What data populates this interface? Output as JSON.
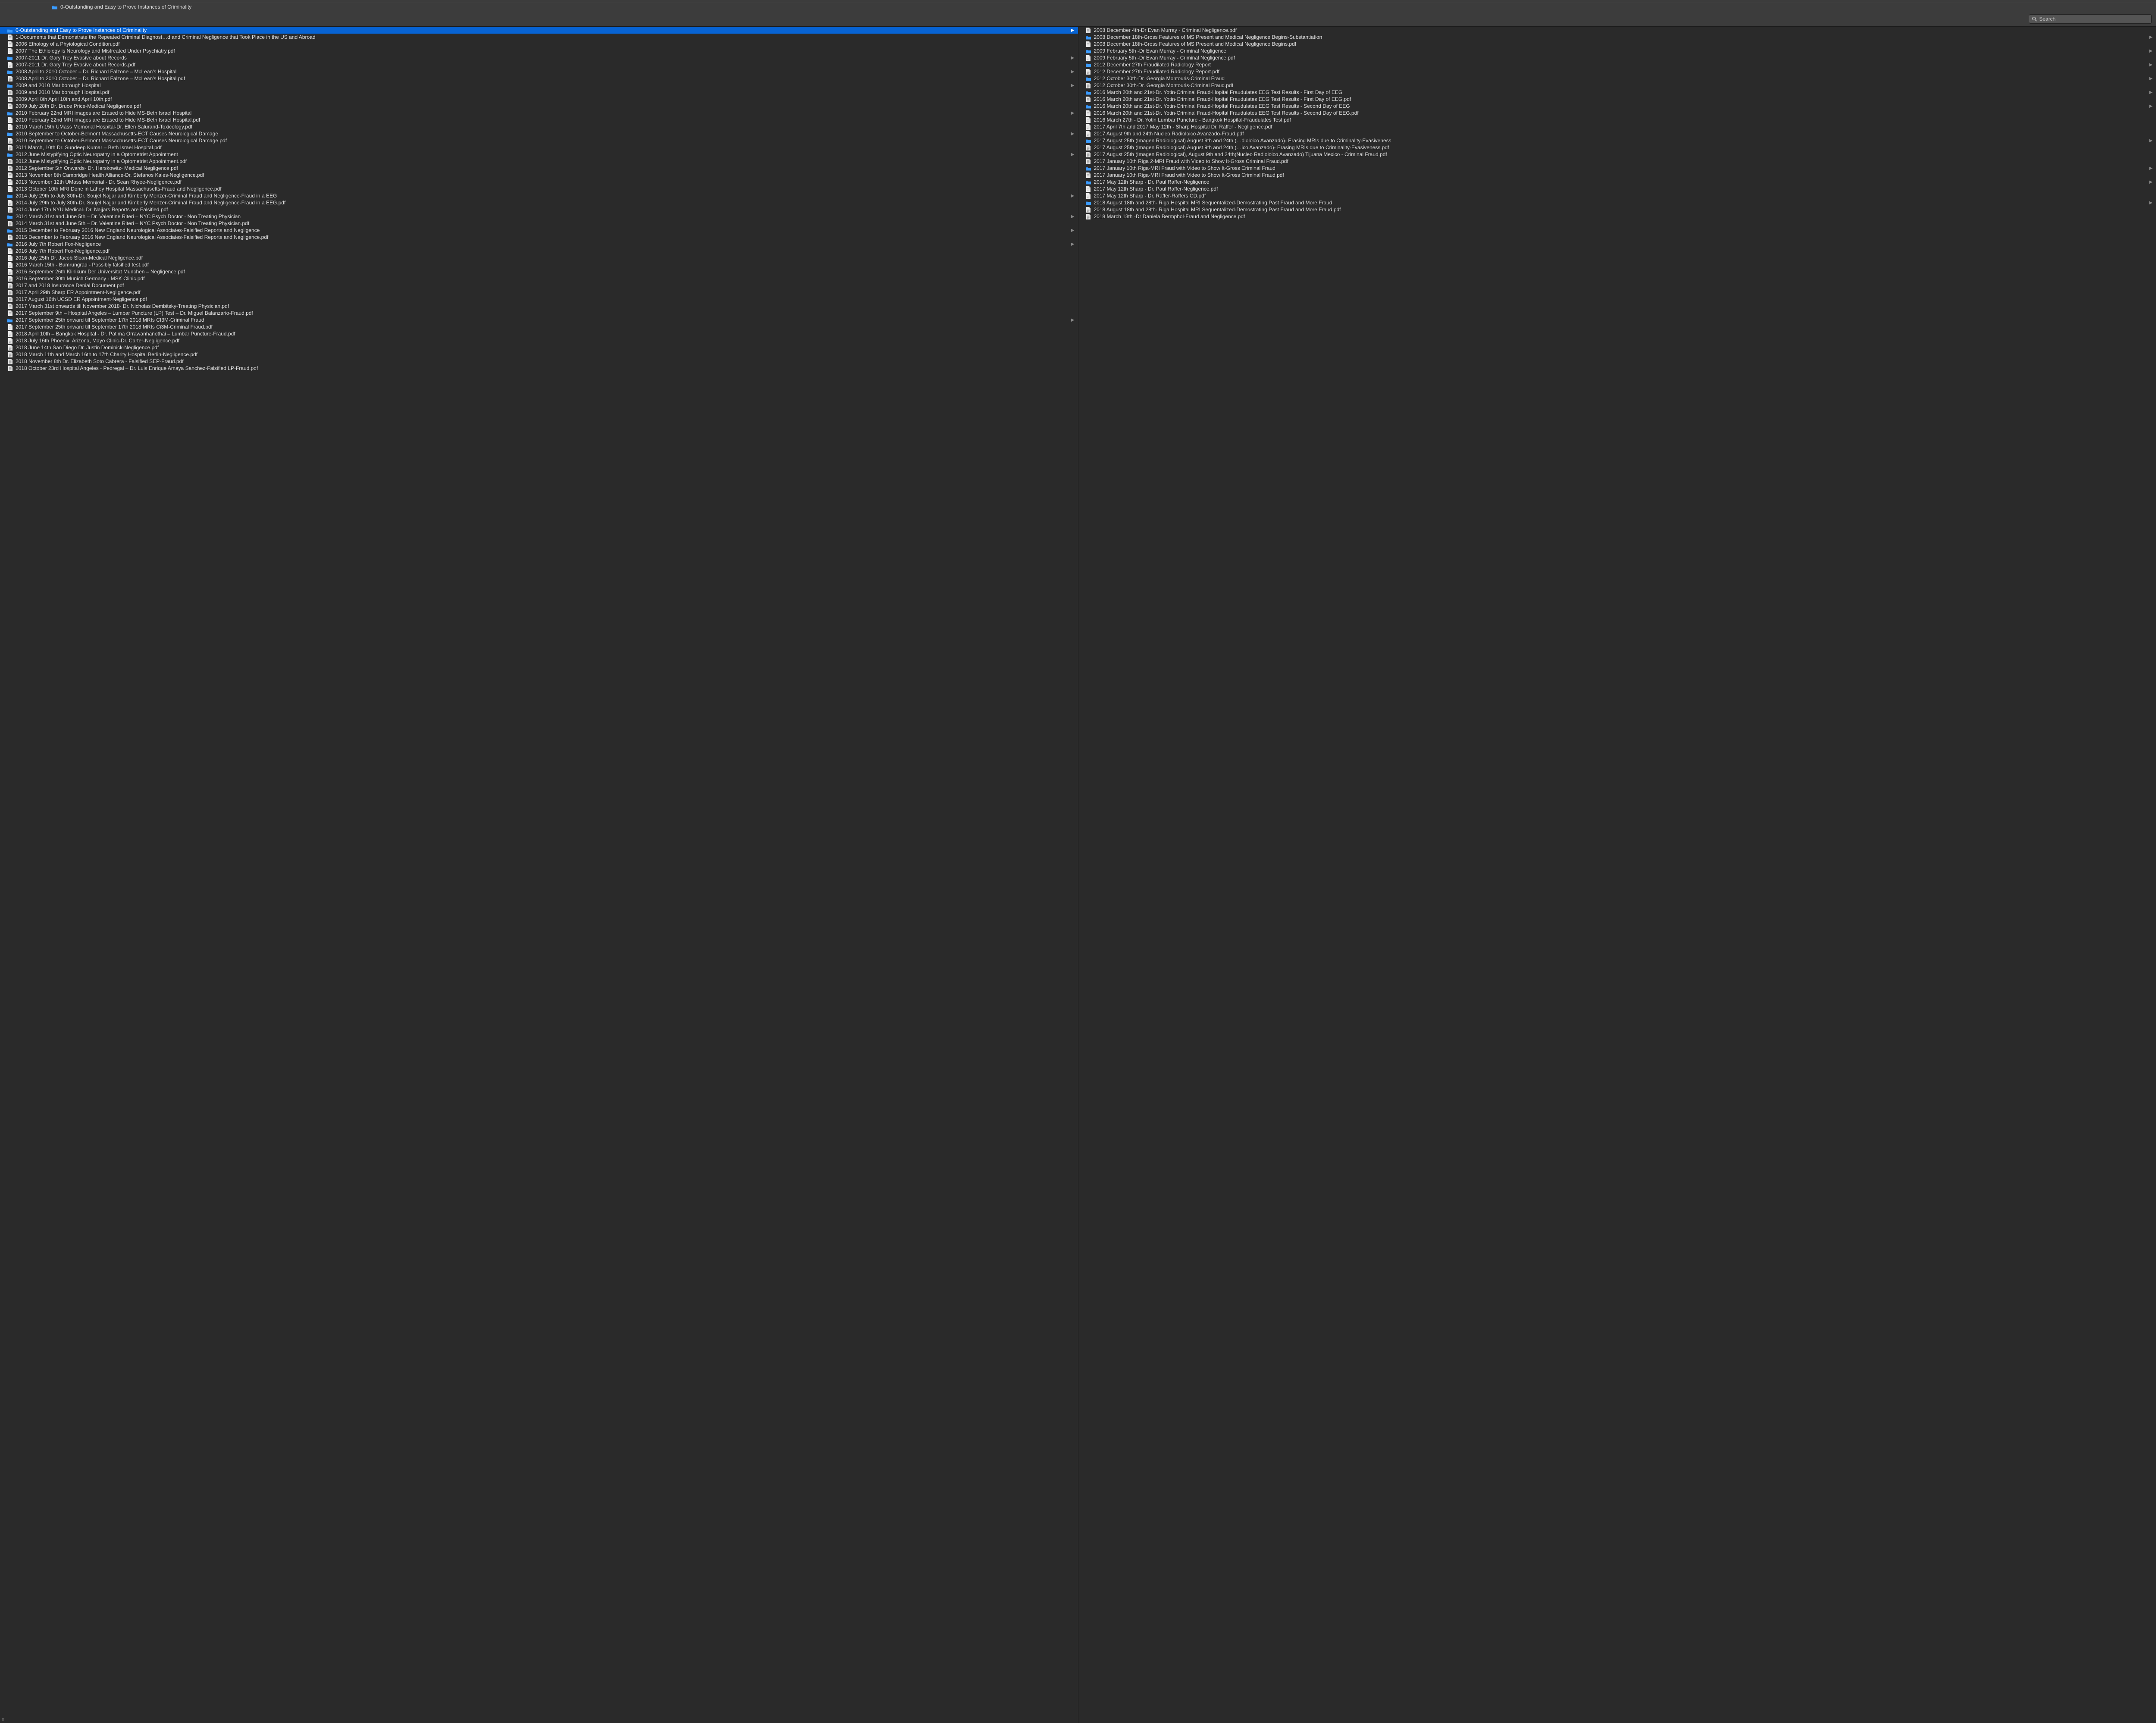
{
  "pathbar": {
    "title": "0-Outstanding and Easy to Prove Instances of Criminality"
  },
  "search": {
    "placeholder": "Search",
    "value": ""
  },
  "columns": [
    {
      "items": [
        {
          "type": "folder",
          "selected": true,
          "name": "0-Outstanding and Easy to Prove Instances of Criminality"
        },
        {
          "type": "doc",
          "name": "1-Documents that Demonstrate the Repeated Criminal Diagnost…d and Criminal Negligence that Took Place in the US and Abroad"
        },
        {
          "type": "doc",
          "name": "2006 Ethology of a Phyiological Condition.pdf"
        },
        {
          "type": "doc",
          "name": "2007 The Ethiology is Neurology and Mistreated Under Psychiatry.pdf"
        },
        {
          "type": "folder",
          "name": "2007-2011 Dr. Gary Trey Evasive about Records"
        },
        {
          "type": "doc",
          "name": "2007-2011 Dr. Gary Trey Evasive about Records.pdf"
        },
        {
          "type": "folder",
          "name": "2008 April to 2010 October  – Dr. Richard Falzone – McLean's Hospital"
        },
        {
          "type": "doc",
          "name": "2008 April to 2010 October  – Dr. Richard Falzone – McLean's Hospital.pdf"
        },
        {
          "type": "folder",
          "name": "2009 and 2010 Marlborough Hospital"
        },
        {
          "type": "doc",
          "name": "2009 and 2010 Marlborough Hospital.pdf"
        },
        {
          "type": "doc",
          "name": "2009 April 8th April 10th and April 10th.pdf"
        },
        {
          "type": "doc",
          "name": "2009 July 28th Dr. Bruce Price-Medical Negligence.pdf"
        },
        {
          "type": "folder",
          "name": "2010 February 22nd MRI images are Erased to Hide MS-Beth Israel Hospital"
        },
        {
          "type": "doc",
          "name": "2010 February 22nd MRI images are Erased to Hide MS-Beth Israel Hospital.pdf"
        },
        {
          "type": "doc",
          "name": "2010 March 15th UMass Memorial Hospital-Dr. Ellen Salurand-Toxicology.pdf"
        },
        {
          "type": "folder",
          "name": "2010 September to October-Belmont Massachusetts-ECT Causes Neurological Damage"
        },
        {
          "type": "doc",
          "name": "2010 September to October-Belmont Massachusetts-ECT Causes Neurological Damage.pdf"
        },
        {
          "type": "doc",
          "name": "2011 March, 10th  Dr. Sundeep Kumar – Beth Israel Hospital.pdf"
        },
        {
          "type": "folder",
          "name": "2012 June Mistypifying Optic Neuropathy in a Optometrist Appointment"
        },
        {
          "type": "doc",
          "name": "2012 June Mistypifying Optic Neuropathy in a Optometrist Appointment.pdf"
        },
        {
          "type": "doc",
          "name": "2012 September 5th Onwards- Dr. Herskowitz- Medical Negligence.pdf"
        },
        {
          "type": "doc",
          "name": "2013 November 8th Cambridge Health Alliance-Dr. Stefanos Kales-Negligence.pdf"
        },
        {
          "type": "doc",
          "name": "2013 November 12th UMass Memorial - Dr. Sean Rhyee-Negligence.pdf"
        },
        {
          "type": "doc",
          "name": "2013 October 10th MRI Done in Lahey Hospital Massachusetts-Fraud and Negligence.pdf"
        },
        {
          "type": "folder",
          "name": "2014 July 29th to July 30th-Dr. Soujel Najjar and Kimberly Menzer-Criminal Fraud and Negligence-Fraud in a EEG"
        },
        {
          "type": "doc",
          "name": "2014 July 29th to July 30th-Dr. Soujel Najjar and Kimberly Menzer-Criminal Fraud and Negligence-Fraud in a EEG.pdf"
        },
        {
          "type": "doc",
          "name": "2014 June 17th NYU Medical- Dr. Najjars Reports are Falsified.pdf"
        },
        {
          "type": "folder",
          "name": "2014 March 31st and June 5th – Dr. Valentine Riteri – NYC Psych Doctor - Non Treating Physician"
        },
        {
          "type": "doc",
          "name": "2014 March 31st and June 5th – Dr. Valentine Riteri – NYC Psych Doctor - Non Treating Physician.pdf"
        },
        {
          "type": "folder",
          "name": "2015 December to February 2016 New England Neurological Associates-Falsified Reports and Negligence"
        },
        {
          "type": "doc",
          "name": "2015 December to February 2016 New England Neurological Associates-Falsified Reports and Negligence.pdf"
        },
        {
          "type": "folder",
          "name": "2016 July 7th Robert Fox-Negligence"
        },
        {
          "type": "doc",
          "name": "2016 July 7th Robert Fox-Negligence.pdf"
        },
        {
          "type": "doc",
          "name": "2016 July 25th Dr. Jacob Sloan-Medical Negligence.pdf"
        },
        {
          "type": "doc",
          "name": "2016 March 15th - Bumrungrad - Possibly falsified test.pdf"
        },
        {
          "type": "doc",
          "name": "2016 September 26th Klinikum Der Universitat Munchen – Negligence.pdf"
        },
        {
          "type": "doc",
          "name": "2016 September 30th Munich Germany - MSK Clinic.pdf"
        },
        {
          "type": "doc",
          "name": "2017 and 2018 Insurance Denial Document.pdf"
        },
        {
          "type": "doc",
          "name": "2017 April 29th Sharp ER Appointment-Negligence.pdf"
        },
        {
          "type": "doc",
          "name": "2017 August 16th  UCSD ER Appointment-Negligence.pdf"
        },
        {
          "type": "doc",
          "name": "2017 March 31st onwards till November 2018- Dr. Nicholas Dembitsky-Treating Physician.pdf"
        },
        {
          "type": "doc",
          "name": "2017 September 9th – Hospital Angeles – Lumbar Puncture (LP) Test – Dr. Miguel Balanzario-Fraud.pdf"
        },
        {
          "type": "folder",
          "name": "2017 September 25th onward till September 17th 2018  MRIs CI3M-Criminal Fraud"
        },
        {
          "type": "doc",
          "name": "2017 September 25th onward till September 17th 2018  MRIs Ci3M-Criminal Fraud.pdf"
        },
        {
          "type": "doc",
          "name": "2018 April 10th – Bangkok Hospital - Dr. Patima Orrawanhanothai – Lumbar Puncture-Fraud.pdf"
        },
        {
          "type": "doc",
          "name": "2018 July 16th  Phoenix, Arizona, Mayo Clinic-Dr. Carter-Negligence.pdf"
        },
        {
          "type": "doc",
          "name": "2018 June 14th San Diego Dr. Justin Dominick-Negligence.pdf"
        },
        {
          "type": "doc",
          "name": "2018 March 11th and March 16th to 17th Charity Hospital Berlin-Negligence.pdf"
        },
        {
          "type": "doc",
          "name": "2018 November 8th Dr. Elizabeth Soto Cabrera - Falsified SEP-Fraud.pdf"
        },
        {
          "type": "doc",
          "name": "2018 October 23rd Hospital Angeles - Pedregal – Dr. Luis Enrique Amaya Sanchez-Falsified LP-Fraud.pdf"
        }
      ]
    },
    {
      "items": [
        {
          "type": "doc",
          "name": "2008 December 4th-Dr Evan Murray - Criminal Negligence.pdf"
        },
        {
          "type": "folder",
          "name": "2008 December 18th-Gross Features of MS Present and Medical Negligence Begins-Substantiation"
        },
        {
          "type": "doc",
          "name": "2008 December 18th-Gross Features of MS Present and Medical Negligence Begins.pdf"
        },
        {
          "type": "folder",
          "name": "2009 February 5th -Dr Evan Murray - Criminal Negligence"
        },
        {
          "type": "doc",
          "name": "2009 February 5th -Dr Evan Murray - Criminal Negligence.pdf"
        },
        {
          "type": "folder",
          "name": "2012 December 27th Fraudilated Radiology Report"
        },
        {
          "type": "doc",
          "name": "2012 December 27th Fraudilated Radiology Report.pdf"
        },
        {
          "type": "folder",
          "name": "2012 October 30th-Dr. Georgia Montouris-Criminal Fraud"
        },
        {
          "type": "doc",
          "name": "2012 October 30th-Dr. Georgia Montouris-Criminal Fraud.pdf"
        },
        {
          "type": "folder",
          "name": "2016 March 20th and 21st-Dr. Yotin-Criminal Fraud-Hopital Fraudulates EEG Test Results - First Day of EEG"
        },
        {
          "type": "doc",
          "name": "2016 March 20th and 21st-Dr. Yotin-Criminal Fraud-Hopital Fraudulates EEG Test Results - First Day of EEG.pdf"
        },
        {
          "type": "folder",
          "name": "2016 March 20th and 21st-Dr. Yotin-Criminal Fraud-Hopital Fraudulates EEG Test Results - Second Day of EEG"
        },
        {
          "type": "doc",
          "name": "2016 March 20th and 21st-Dr. Yotin-Criminal Fraud-Hopital Fraudulates EEG Test Results - Second Day of EEG.pdf"
        },
        {
          "type": "doc",
          "name": "2016 March 27th - Dr. Yotin Lumbar Puncture - Bangkok Hospital-Fraudulates Test.pdf"
        },
        {
          "type": "doc",
          "name": "2017 April 7th and 2017 May 12th - Sharp Hospital Dr. Raffer - Negligence.pdf"
        },
        {
          "type": "doc",
          "name": "2017 August 9th and 24th Nucleo Radioloico Avanzado-Fraud.pdf"
        },
        {
          "type": "folder",
          "name": "2017 August 25th (Imagen Radiological) August 9th and 24th (…dioloico Avanzado)- Erasing MRIs due to Criminality-Evasiveness"
        },
        {
          "type": "doc",
          "name": "2017 August 25th (Imagen Radiological) August 9th and 24th (…ico Avanzado)- Erasing MRIs due to Criminality-Evasiveness.pdf"
        },
        {
          "type": "doc",
          "name": "2017 August 25th (Imagen Radiological), August 9th and 24th(Nucleo Radioloico Avanzado) Tijuana Mexico - Criminal Fraud.pdf"
        },
        {
          "type": "doc",
          "name": "2017 January 10th Riga 2-MRI Fraud with Video to Show It-Gross Criminal Fraud.pdf"
        },
        {
          "type": "folder",
          "name": "2017 January 10th Riga-MRI Fraud with Video to Show It-Gross Criminal Fraud"
        },
        {
          "type": "doc",
          "name": "2017 January 10th Riga-MRI Fraud with Video to Show It-Gross Criminal Fraud.pdf"
        },
        {
          "type": "folder",
          "name": "2017 May 12th Sharp - Dr. Paul Raffer-Negligence"
        },
        {
          "type": "doc",
          "name": "2017 May 12th Sharp - Dr. Paul Raffer-Negligence.pdf"
        },
        {
          "type": "doc",
          "name": "2017 May 12th Sharp - Dr. Raffer-Raffers CD.pdf"
        },
        {
          "type": "folder",
          "name": "2018 August 18th and 28th- Riga Hospital MRI Sequentalized-Demostrating Past Fraud and More Fraud"
        },
        {
          "type": "doc",
          "name": "2018 August 18th and 28th- Riga Hospital MRI Sequentalized-Demostrating Past Fraud and More Fraud.pdf"
        },
        {
          "type": "doc",
          "name": "2018 March 13th -Dr Daniela Bermphol-Fraud and Negligence.pdf"
        }
      ]
    }
  ]
}
